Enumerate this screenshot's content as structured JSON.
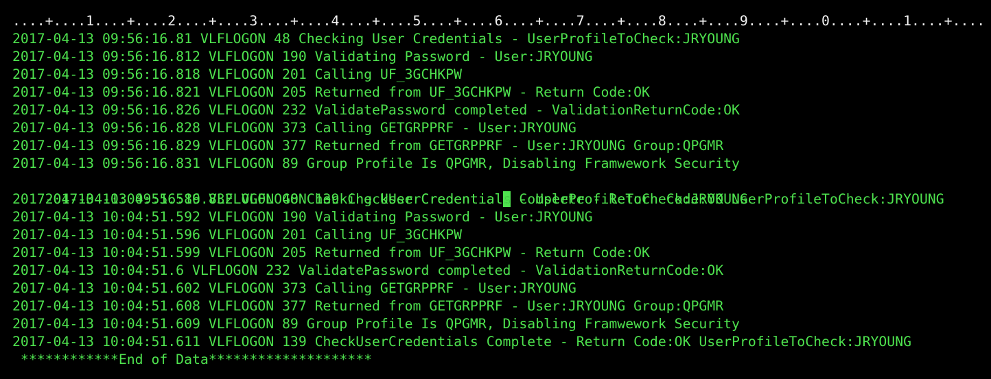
{
  "ruler": "....+....1....+....2....+....3....+....4....+....5....+....6....+....7....+....8....+....9....+....0....+....1....+....",
  "lines": [
    "2017-04-13 09:56:16.81 VLFLOGON 48 Checking User Credentials - UserProfileToCheck:JRYOUNG",
    "2017-04-13 09:56:16.812 VLFLOGON 190 Validating Password - User:JRYOUNG",
    "2017-04-13 09:56:16.818 VLFLOGON 201 Calling UF_3GCHKPW",
    "2017-04-13 09:56:16.821 VLFLOGON 205 Returned from UF_3GCHKPW - Return Code:OK",
    "2017-04-13 09:56:16.826 VLFLOGON 232 ValidatePassword completed - ValidationReturnCode:OK",
    "2017-04-13 09:56:16.828 VLFLOGON 373 Calling GETGRPPRF - User:JRYOUNG",
    "2017-04-13 09:56:16.829 VLFLOGON 377 Returned from GETGRPPRF - User:JRYOUNG Group:QPGMR",
    "2017-04-13 09:56:16.831 VLFLOGON 89 Group Profile Is QPGMR, Disabling Framwework Security",
    "2017-04-13 09:56:16.832 VLFLOGON 139 CheckUserCredentials Complete - Return Code:OK UserProfileToCheck:JRYOUNG",
    "2017-04-13 10:04:51.589 VLFLOGON 48 Checking User Credentials - UserProfileToCheck:JRYOUNG",
    "2017-04-13 10:04:51.592 VLFLOGON 190 Validating Password - User:JRYOUNG",
    "2017-04-13 10:04:51.596 VLFLOGON 201 Calling UF_3GCHKPW",
    "2017-04-13 10:04:51.599 VLFLOGON 205 Returned from UF_3GCHKPW - Return Code:OK",
    "2017-04-13 10:04:51.6 VLFLOGON 232 ValidatePassword completed - ValidationReturnCode:OK",
    "2017-04-13 10:04:51.602 VLFLOGON 373 Calling GETGRPPRF - User:JRYOUNG",
    "2017-04-13 10:04:51.608 VLFLOGON 377 Returned from GETGRPPRF - User:JRYOUNG Group:QPGMR",
    "2017-04-13 10:04:51.609 VLFLOGON 89 Group Profile Is QPGMR, Disabling Framwework Security",
    "2017-04-13 10:04:51.611 VLFLOGON 139 CheckUserCredentials Complete - Return Code:OK UserProfileToCheck:JRYOUNG"
  ],
  "cursor_line": {
    "before": "2017-04-13 09:56:16.832 VLFLOGON 139 CheckUserCredential",
    "char": "s",
    "after": " Complete - Return Code:OK UserProfileToCheck:JRYOUNG"
  },
  "footer": " ************End of Data********************",
  "colors": {
    "text": "#4ee24e",
    "ruler": "#f2f2f2",
    "background": "#000000"
  }
}
